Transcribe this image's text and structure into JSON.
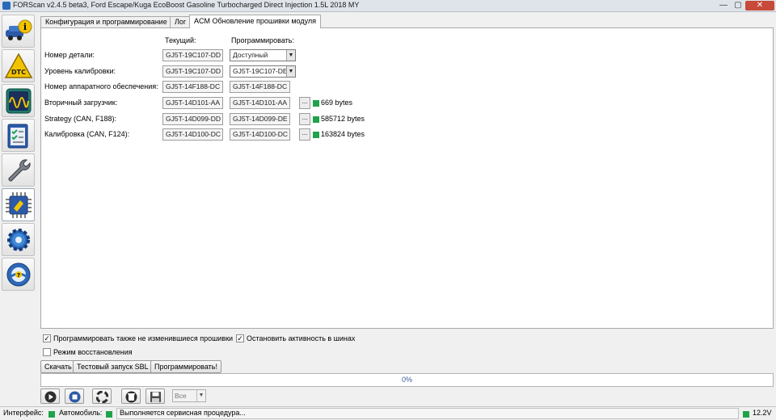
{
  "window": {
    "title": "FORScan v2.4.5 beta3, Ford Escape/Kuga EcoBoost Gasoline Turbocharged Direct Injection 1.5L 2018 MY",
    "minimize": "—",
    "maximize": "▢",
    "close": "✕"
  },
  "sidebar": {
    "items": [
      {
        "name": "vehicle-info",
        "icon": "car-info-icon"
      },
      {
        "name": "dtc",
        "icon": "dtc-warning-icon"
      },
      {
        "name": "oscilloscope",
        "icon": "oscilloscope-icon"
      },
      {
        "name": "tests",
        "icon": "checklist-icon"
      },
      {
        "name": "service",
        "icon": "wrench-icon"
      },
      {
        "name": "configuration-programming",
        "icon": "chip-icon"
      },
      {
        "name": "settings",
        "icon": "gear-icon"
      },
      {
        "name": "help",
        "icon": "help-wheel-icon"
      }
    ],
    "active_index": 5
  },
  "tabs": [
    {
      "label": "Конфигурация и программирование"
    },
    {
      "label": "Лог"
    },
    {
      "label": "ACM Обновление прошивки модуля"
    }
  ],
  "form": {
    "col_current": "Текущий:",
    "col_program": "Программировать:",
    "rows": [
      {
        "label": "Номер детали:",
        "current": "GJ5T-19C107-DD",
        "program": "Доступный",
        "kind": "select"
      },
      {
        "label": "Уровень калибровки:",
        "current": "GJ5T-19C107-DD",
        "program": "GJ5T-19C107-DE",
        "kind": "select"
      },
      {
        "label": "Номер аппаратного обеспечения:",
        "current": "GJ5T-14F188-DC",
        "program": "GJ5T-14F188-DC",
        "kind": "field"
      },
      {
        "label": "Вторичный загрузчик:",
        "current": "GJ5T-14D101-AA",
        "program": "GJ5T-14D101-AA",
        "kind": "file",
        "size": "669 bytes"
      },
      {
        "label": "Strategy (CAN, F188):",
        "current": "GJ5T-14D099-DD",
        "program": "GJ5T-14D099-DE",
        "kind": "file",
        "size": "585712 bytes"
      },
      {
        "label": "Калибровка (CAN, F124):",
        "current": "GJ5T-14D100-DC",
        "program": "GJ5T-14D100-DC",
        "kind": "file",
        "size": "163824 bytes"
      }
    ],
    "browse_label": "..."
  },
  "options": {
    "program_unchanged": {
      "label": "Программировать также не изменившиеся прошивки",
      "checked": true,
      "mark": "✓"
    },
    "stop_bus": {
      "label": "Остановить активность в шинах",
      "checked": true,
      "mark": "✓"
    },
    "recovery": {
      "label": "Режим восстановления",
      "checked": false,
      "mark": ""
    }
  },
  "actions": {
    "download": "Скачать",
    "test_sbl": "Тестовый запуск SBL",
    "program": "Программировать!"
  },
  "progress": {
    "value": 0,
    "label": "0%"
  },
  "controls": {
    "filter_value": "Все",
    "icons": [
      "play-icon",
      "stop-icon",
      "lifebuoy-icon",
      "clear-icon",
      "save-icon"
    ]
  },
  "status": {
    "interface_label": "Интерфейс:",
    "vehicle_label": "Автомобиль:",
    "message": "Выполняется сервисная процедура...",
    "voltage": "12.2V",
    "ok_color": "#1fa34a"
  }
}
